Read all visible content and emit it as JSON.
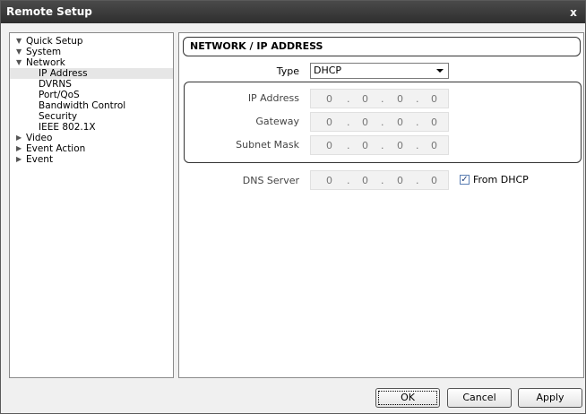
{
  "window": {
    "title": "Remote Setup",
    "close_glyph": "x"
  },
  "tree": [
    {
      "label": "Quick Setup",
      "level": 0,
      "expanded": true
    },
    {
      "label": "System",
      "level": 0,
      "expanded": true
    },
    {
      "label": "Network",
      "level": 0,
      "expanded": true
    },
    {
      "label": "IP Address",
      "level": 1,
      "selected": true
    },
    {
      "label": "DVRNS",
      "level": 1
    },
    {
      "label": "Port/QoS",
      "level": 1
    },
    {
      "label": "Bandwidth Control",
      "level": 1
    },
    {
      "label": "Security",
      "level": 1
    },
    {
      "label": "IEEE 802.1X",
      "level": 1
    },
    {
      "label": "Video",
      "level": 0,
      "expanded": false
    },
    {
      "label": "Event Action",
      "level": 0,
      "expanded": false
    },
    {
      "label": "Event",
      "level": 0,
      "expanded": false
    }
  ],
  "panel": {
    "header": "NETWORK / IP ADDRESS",
    "type_label": "Type",
    "type_value": "DHCP",
    "ip_label": "IP Address",
    "gateway_label": "Gateway",
    "subnet_label": "Subnet Mask",
    "dns_label": "DNS Server",
    "ip_octets": [
      "0",
      "0",
      "0",
      "0"
    ],
    "gateway_octets": [
      "0",
      "0",
      "0",
      "0"
    ],
    "subnet_octets": [
      "0",
      "0",
      "0",
      "0"
    ],
    "dns_octets": [
      "0",
      "0",
      "0",
      "0"
    ],
    "from_dhcp_label": "From DHCP",
    "from_dhcp_checked": true,
    "check_glyph": "✓"
  },
  "buttons": {
    "ok": "OK",
    "cancel": "Cancel",
    "apply": "Apply"
  },
  "colors": {
    "titlebar": "#3a3a3a",
    "selection": "#e6e6e6"
  },
  "icons": {
    "expanded": "▼",
    "collapsed": "▶"
  }
}
